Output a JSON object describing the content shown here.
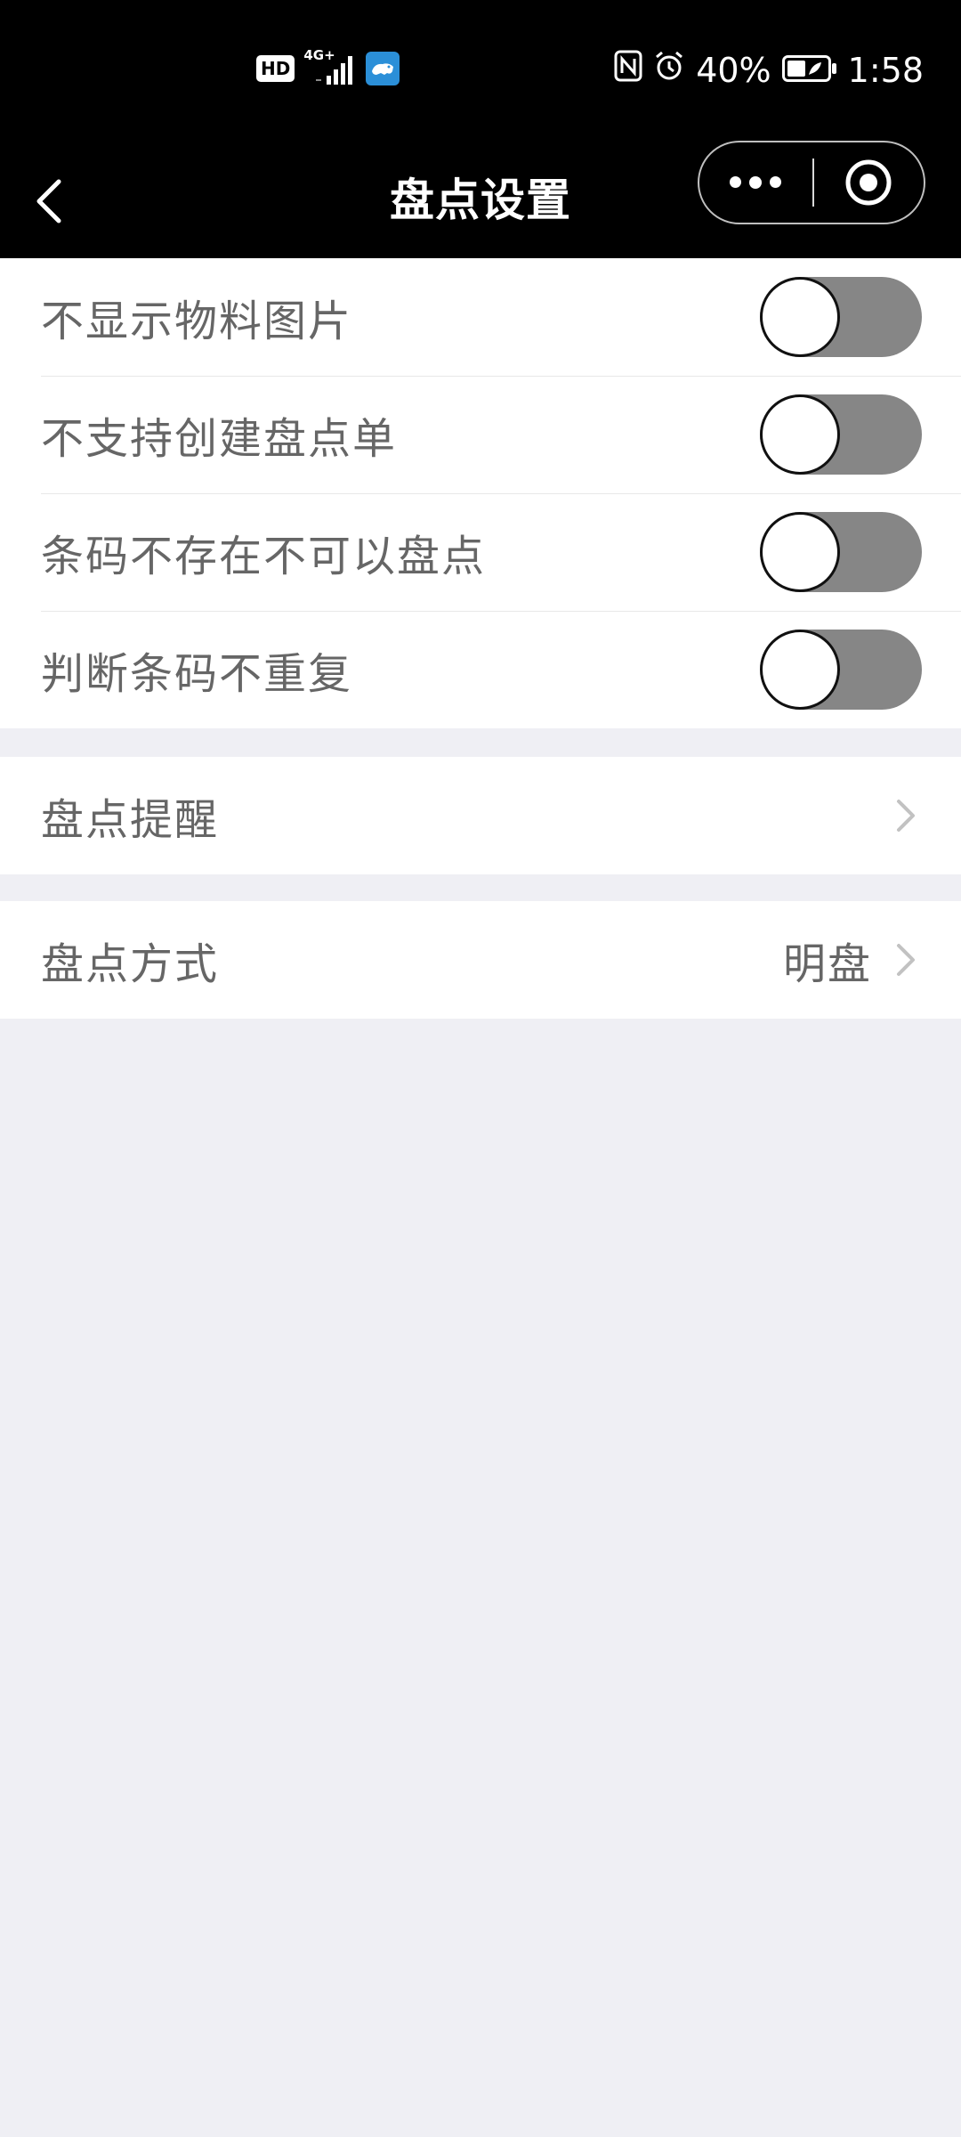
{
  "status_bar": {
    "hd_label": "HD",
    "network_label": "4G+",
    "battery_percent": "40%",
    "time": "1:58",
    "icons": [
      "hd-icon",
      "signal-icon",
      "app-notification-icon",
      "nfc-icon",
      "alarm-icon",
      "battery-icon"
    ]
  },
  "nav": {
    "title": "盘点设置",
    "back_icon": "chevron-left-icon",
    "more_icon": "more-dots-icon",
    "close_icon": "target-close-icon"
  },
  "toggles": [
    {
      "label": "不显示物料图片",
      "on": false
    },
    {
      "label": "不支持创建盘点单",
      "on": false
    },
    {
      "label": "条码不存在不可以盘点",
      "on": false
    },
    {
      "label": "判断条码不重复",
      "on": false
    }
  ],
  "reminder": {
    "label": "盘点提醒"
  },
  "method": {
    "label": "盘点方式",
    "value": "明盘"
  },
  "colors": {
    "bar_bg": "#000000",
    "page_bg": "#efeff4",
    "toggle_off": "#868686",
    "label_text": "#666666"
  }
}
